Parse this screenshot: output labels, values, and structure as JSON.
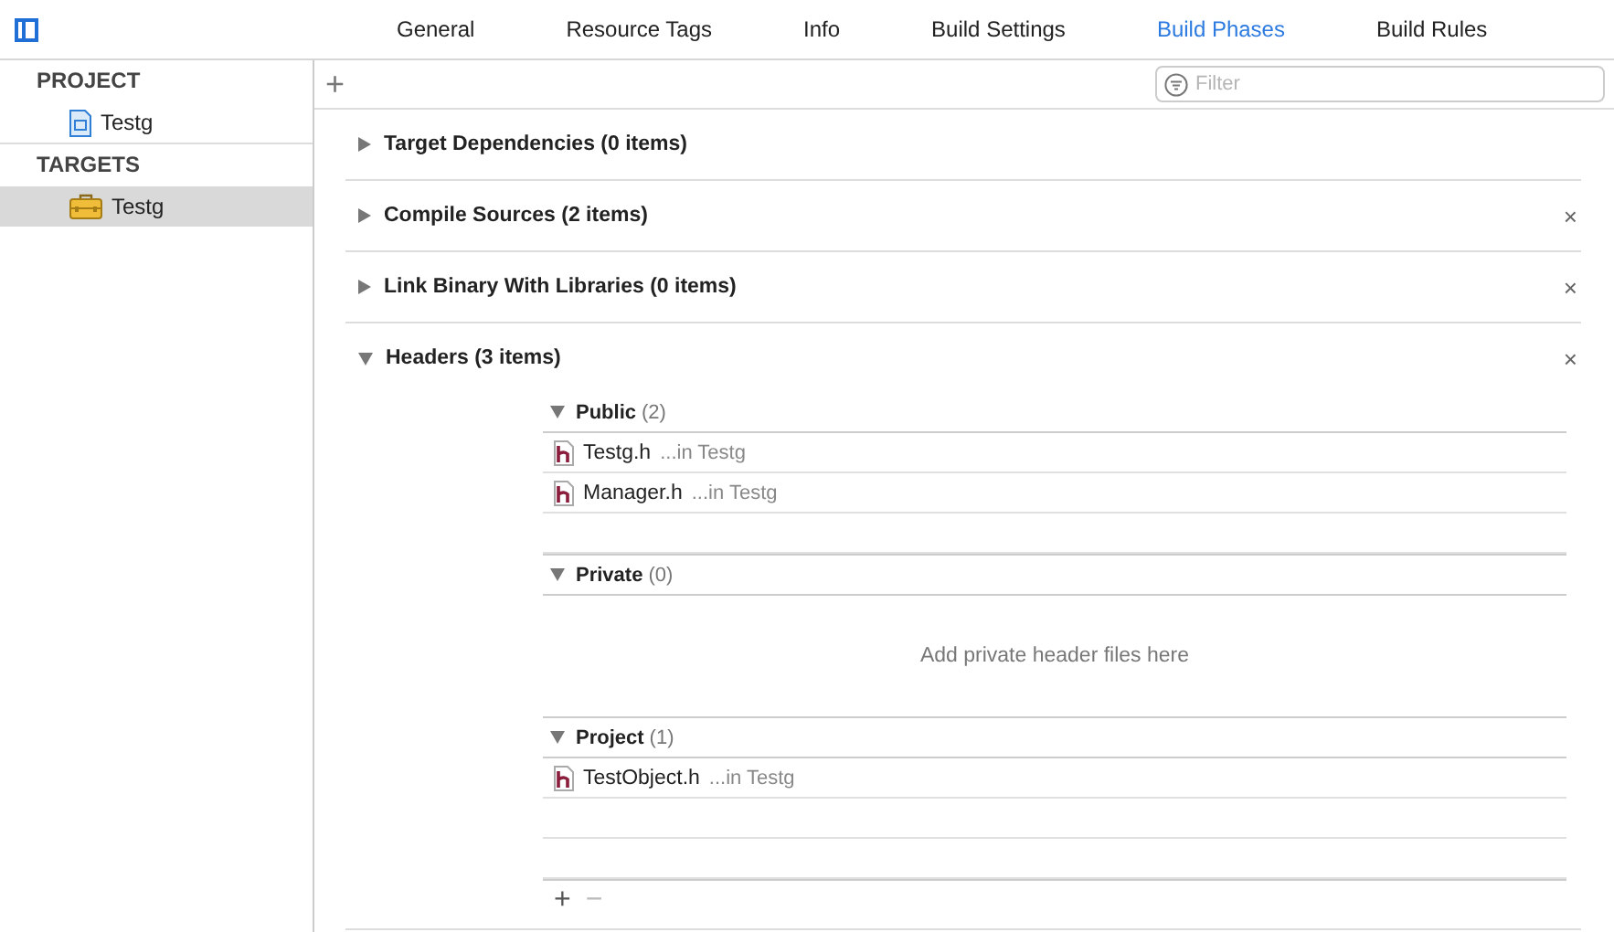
{
  "tabs": [
    {
      "label": "General",
      "selected": false
    },
    {
      "label": "Resource Tags",
      "selected": false
    },
    {
      "label": "Info",
      "selected": false
    },
    {
      "label": "Build Settings",
      "selected": false
    },
    {
      "label": "Build Phases",
      "selected": true
    },
    {
      "label": "Build Rules",
      "selected": false
    }
  ],
  "sidebar": {
    "sections": [
      {
        "title": "PROJECT",
        "items": [
          {
            "label": "Testg",
            "kind": "project",
            "selected": false
          }
        ]
      },
      {
        "title": "TARGETS",
        "items": [
          {
            "label": "Testg",
            "kind": "target",
            "selected": true
          }
        ]
      }
    ]
  },
  "toolbar": {
    "add": "+",
    "filter": {
      "placeholder": "Filter"
    }
  },
  "phases": [
    {
      "title": "Target Dependencies (0 items)",
      "expanded": false
    },
    {
      "title": "Compile Sources (2 items)",
      "expanded": false,
      "delete": "×"
    },
    {
      "title": "Link Binary With Libraries (0 items)",
      "expanded": false,
      "delete": "×"
    },
    {
      "title": "Headers (3 items)",
      "expanded": true,
      "delete": "×",
      "groups": [
        {
          "name": "Public",
          "count": "(2)",
          "files": [
            {
              "name": "Testg.h",
              "location": "...in Testg"
            },
            {
              "name": "Manager.h",
              "location": "...in Testg"
            }
          ]
        },
        {
          "name": "Private",
          "count": "(0)",
          "placeholder": "Add private header files here"
        },
        {
          "name": "Project",
          "count": "(1)",
          "files": [
            {
              "name": "TestObject.h",
              "location": "...in Testg"
            }
          ]
        }
      ],
      "add": "+",
      "remove": {
        "label": "−",
        "disabled": true
      }
    }
  ]
}
